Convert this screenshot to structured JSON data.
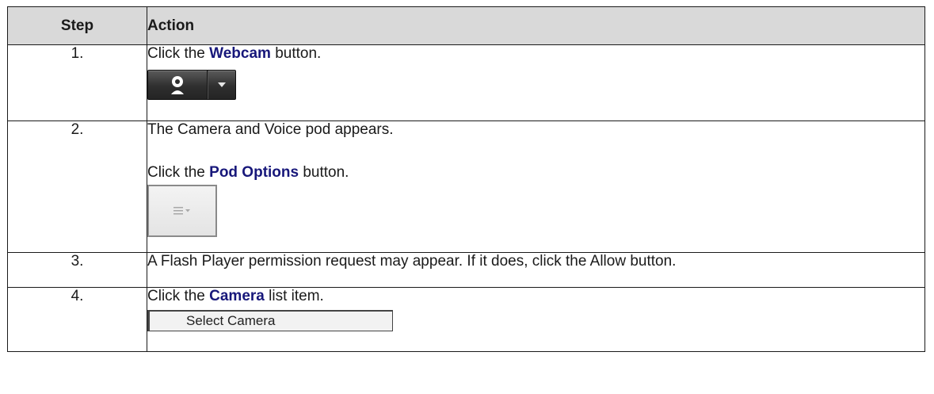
{
  "headers": {
    "step": "Step",
    "action": "Action"
  },
  "rows": [
    {
      "step": "1.",
      "pre": "Click the ",
      "keyword": "Webcam",
      "post": " button."
    },
    {
      "step": "2.",
      "intro": "The Camera and Voice pod appears.",
      "pre": "Click the ",
      "keyword": "Pod Options",
      "post": " button."
    },
    {
      "step": "3.",
      "text": "A Flash Player permission request may appear.  If it does, click the Allow button."
    },
    {
      "step": "4.",
      "pre": "Click the ",
      "keyword": "Camera",
      "post": " list item.",
      "select_label": "Select Camera"
    }
  ],
  "icons": {
    "webcam": "webcam-icon",
    "dropdown": "chevron-down-icon",
    "pod_options": "menu-lines-icon"
  },
  "colors": {
    "keyword": "#17177a",
    "header_bg": "#d9d9d9"
  }
}
